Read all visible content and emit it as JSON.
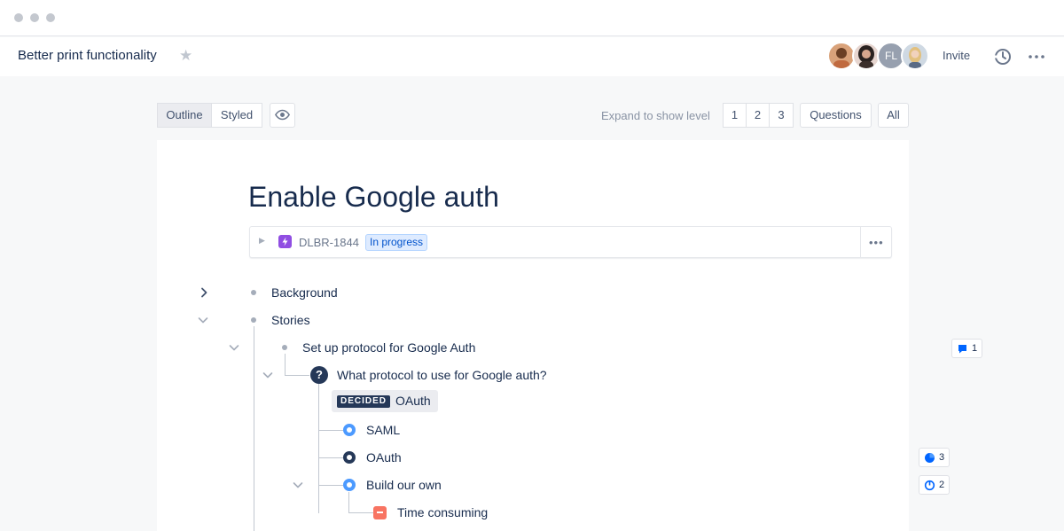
{
  "header": {
    "title": "Better print functionality",
    "avatar_initials": "FL",
    "invite_label": "Invite"
  },
  "toolbar": {
    "view_modes": [
      "Outline",
      "Styled"
    ],
    "active_view": "Outline",
    "expand_label": "Expand to show level",
    "levels": [
      "1",
      "2",
      "3"
    ],
    "filters": [
      "Questions",
      "All"
    ]
  },
  "document": {
    "title": "Enable Google auth",
    "issue": {
      "key": "DLBR-1844",
      "status": "In progress",
      "status_color": "#0052cc",
      "type_icon": "lightning-bolt-icon",
      "type_color": "#904ee2"
    }
  },
  "outline": {
    "background": "Background",
    "stories": "Stories",
    "story_item": "Set up protocol for Google Auth",
    "question": "What protocol to use for Google auth?",
    "question_badge": "?",
    "decided_tag": "DECIDED",
    "decided_value": "OAuth",
    "options": [
      "SAML",
      "OAuth",
      "Build our own"
    ],
    "con": "Time consuming"
  },
  "side_badges": {
    "comments": "1",
    "votes": "3",
    "progress": "2"
  },
  "colors": {
    "accent": "#4c9aff",
    "dark": "#253858",
    "con": "#f87462"
  }
}
